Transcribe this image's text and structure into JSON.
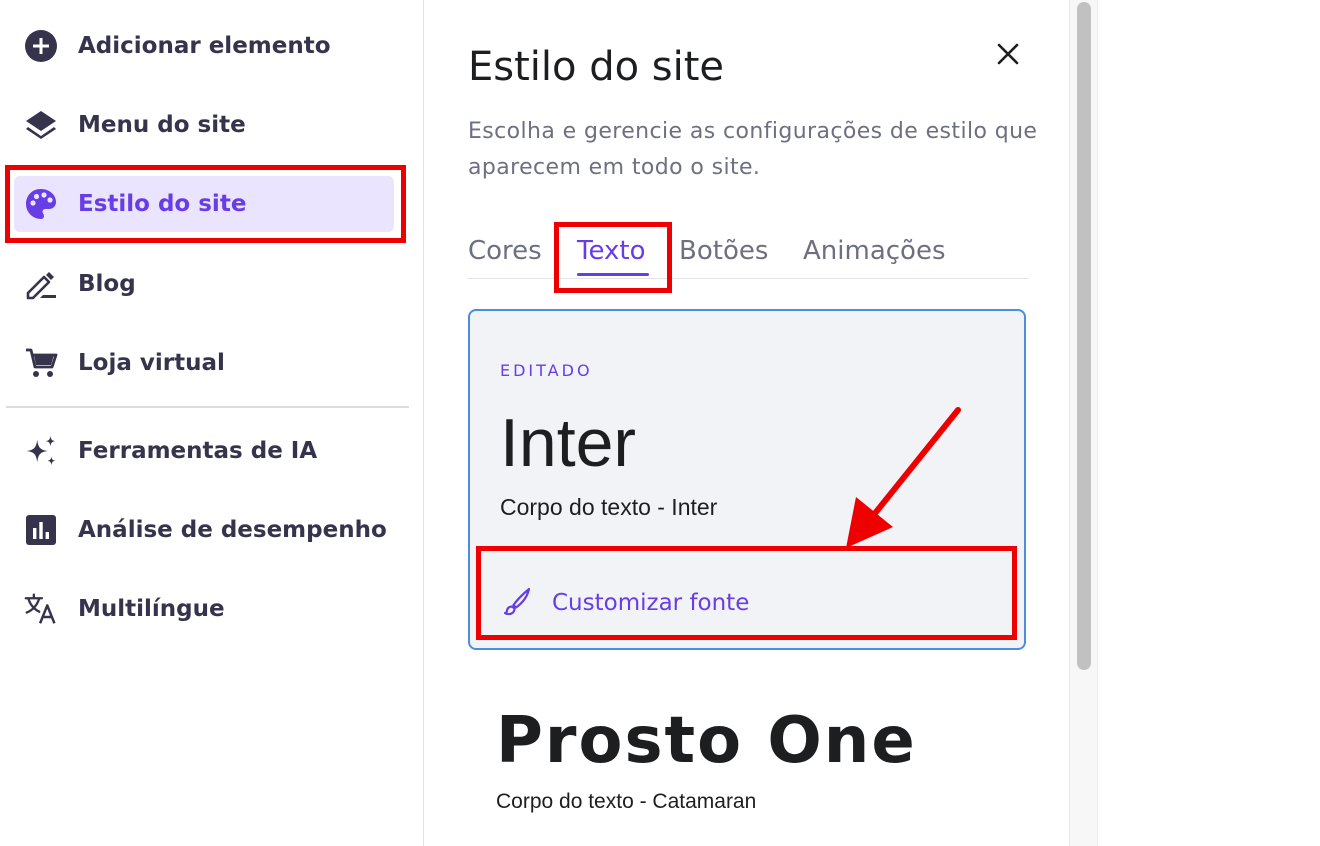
{
  "sidebar": {
    "items": [
      {
        "label": "Adicionar elemento",
        "icon": "add-circle-icon"
      },
      {
        "label": "Menu do site",
        "icon": "layers-icon"
      },
      {
        "label": "Estilo do site",
        "icon": "palette-icon",
        "active": true
      },
      {
        "label": "Blog",
        "icon": "edit-pen-icon"
      },
      {
        "label": "Loja virtual",
        "icon": "shopping-cart-icon"
      },
      {
        "label": "Ferramentas de IA",
        "icon": "ai-sparkles-icon"
      },
      {
        "label": "Análise de desempenho",
        "icon": "bar-chart-icon"
      },
      {
        "label": "Multilíngue",
        "icon": "translate-icon"
      }
    ]
  },
  "panel": {
    "title": "Estilo do site",
    "description": "Escolha e gerencie as configurações de estilo que aparecem em todo o site.",
    "tabs": [
      {
        "label": "Cores"
      },
      {
        "label": "Texto",
        "active": true
      },
      {
        "label": "Botões"
      },
      {
        "label": "Animações"
      }
    ],
    "font_cards": [
      {
        "badge": "EDITADO",
        "heading_font": "Inter",
        "body_font": "Corpo do texto - Inter",
        "customize_label": "Customizar fonte",
        "selected": true
      },
      {
        "heading_font": "Prosto One",
        "body_font": "Corpo do texto - Catamaran"
      }
    ]
  },
  "colors": {
    "accent": "#673de6",
    "active_bg": "#ebe4ff",
    "highlight_red": "#ee0000",
    "card_border": "#4a8ee0"
  }
}
